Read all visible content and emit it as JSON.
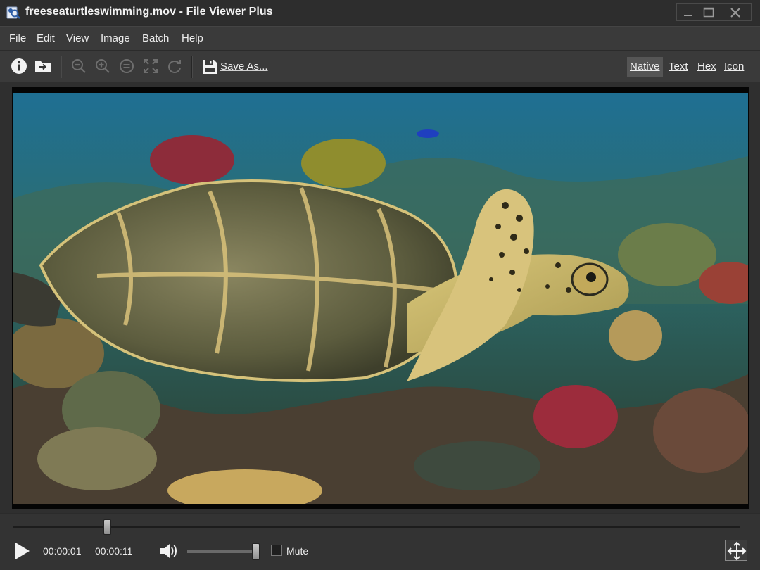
{
  "window": {
    "title": "freeseaturtleswimming.mov - File Viewer Plus",
    "controls": {
      "minimize": "minimize-icon",
      "maximize": "maximize-icon",
      "close": "close-icon"
    }
  },
  "menu": [
    "File",
    "Edit",
    "View",
    "Image",
    "Batch",
    "Help"
  ],
  "toolbar": {
    "buttons": [
      "info-icon",
      "open-folder-icon",
      "zoom-out-icon",
      "zoom-in-icon",
      "zoom-reset-icon",
      "fit-to-window-icon",
      "rotate-icon",
      "save-icon"
    ],
    "save_as_label": "Save As...",
    "view_modes": [
      {
        "label": "Native",
        "active": true
      },
      {
        "label": "Text",
        "active": false
      },
      {
        "label": "Hex",
        "active": false
      },
      {
        "label": "Icon",
        "active": false
      }
    ]
  },
  "player": {
    "current_time": "00:00:01",
    "total_time": "00:00:11",
    "progress_fraction": 0.13,
    "volume_fraction": 0.93,
    "mute_label": "Mute",
    "mute_checked": false
  },
  "colors": {
    "window_bg": "#2b2b2b",
    "menu_bg": "#3a3a3a",
    "active_tab_bg": "#555555",
    "video_bg": "#050505"
  }
}
